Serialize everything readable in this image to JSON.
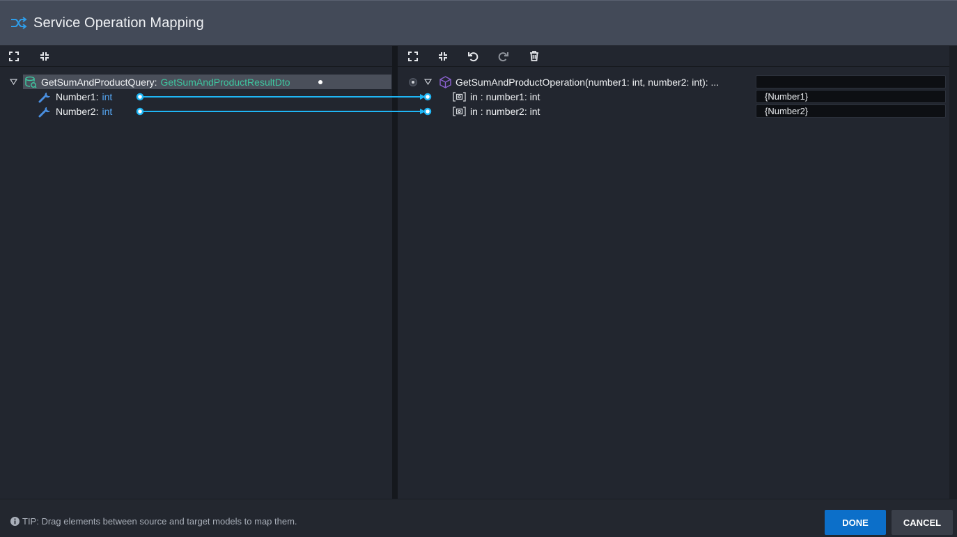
{
  "header": {
    "title": "Service Operation Mapping",
    "icon": "shuffle-icon"
  },
  "source": {
    "toolbar": [
      "expand-all-icon",
      "collapse-all-icon"
    ],
    "root": {
      "name": "GetSumAndProductQuery",
      "type": "GetSumAndProductResultDto",
      "icon": "query-icon"
    },
    "children": [
      {
        "name": "Number1",
        "type": "int",
        "icon": "wrench-icon"
      },
      {
        "name": "Number2",
        "type": "int",
        "icon": "wrench-icon"
      }
    ]
  },
  "target": {
    "toolbar": [
      "expand-all-icon",
      "collapse-all-icon",
      "undo-icon",
      "redo-icon",
      "trash-icon"
    ],
    "root": {
      "name": "GetSumAndProductOperation(number1: int, number2: int): ...",
      "icon": "cube-icon",
      "mapping_value": ""
    },
    "children": [
      {
        "label": "in : number1: int",
        "icon": "parameter-icon",
        "mapping_value": "{Number1}"
      },
      {
        "label": "in : number2: int",
        "icon": "parameter-icon",
        "mapping_value": "{Number2}"
      }
    ]
  },
  "footer": {
    "tip": "TIP: Drag elements between source and target models to map them.",
    "done_label": "DONE",
    "cancel_label": "CANCEL"
  },
  "colors": {
    "accent": "#0c6fc9",
    "type_green": "#3ec6a0",
    "type_blue": "#55a6f2",
    "connector": "#1fb6f5"
  }
}
